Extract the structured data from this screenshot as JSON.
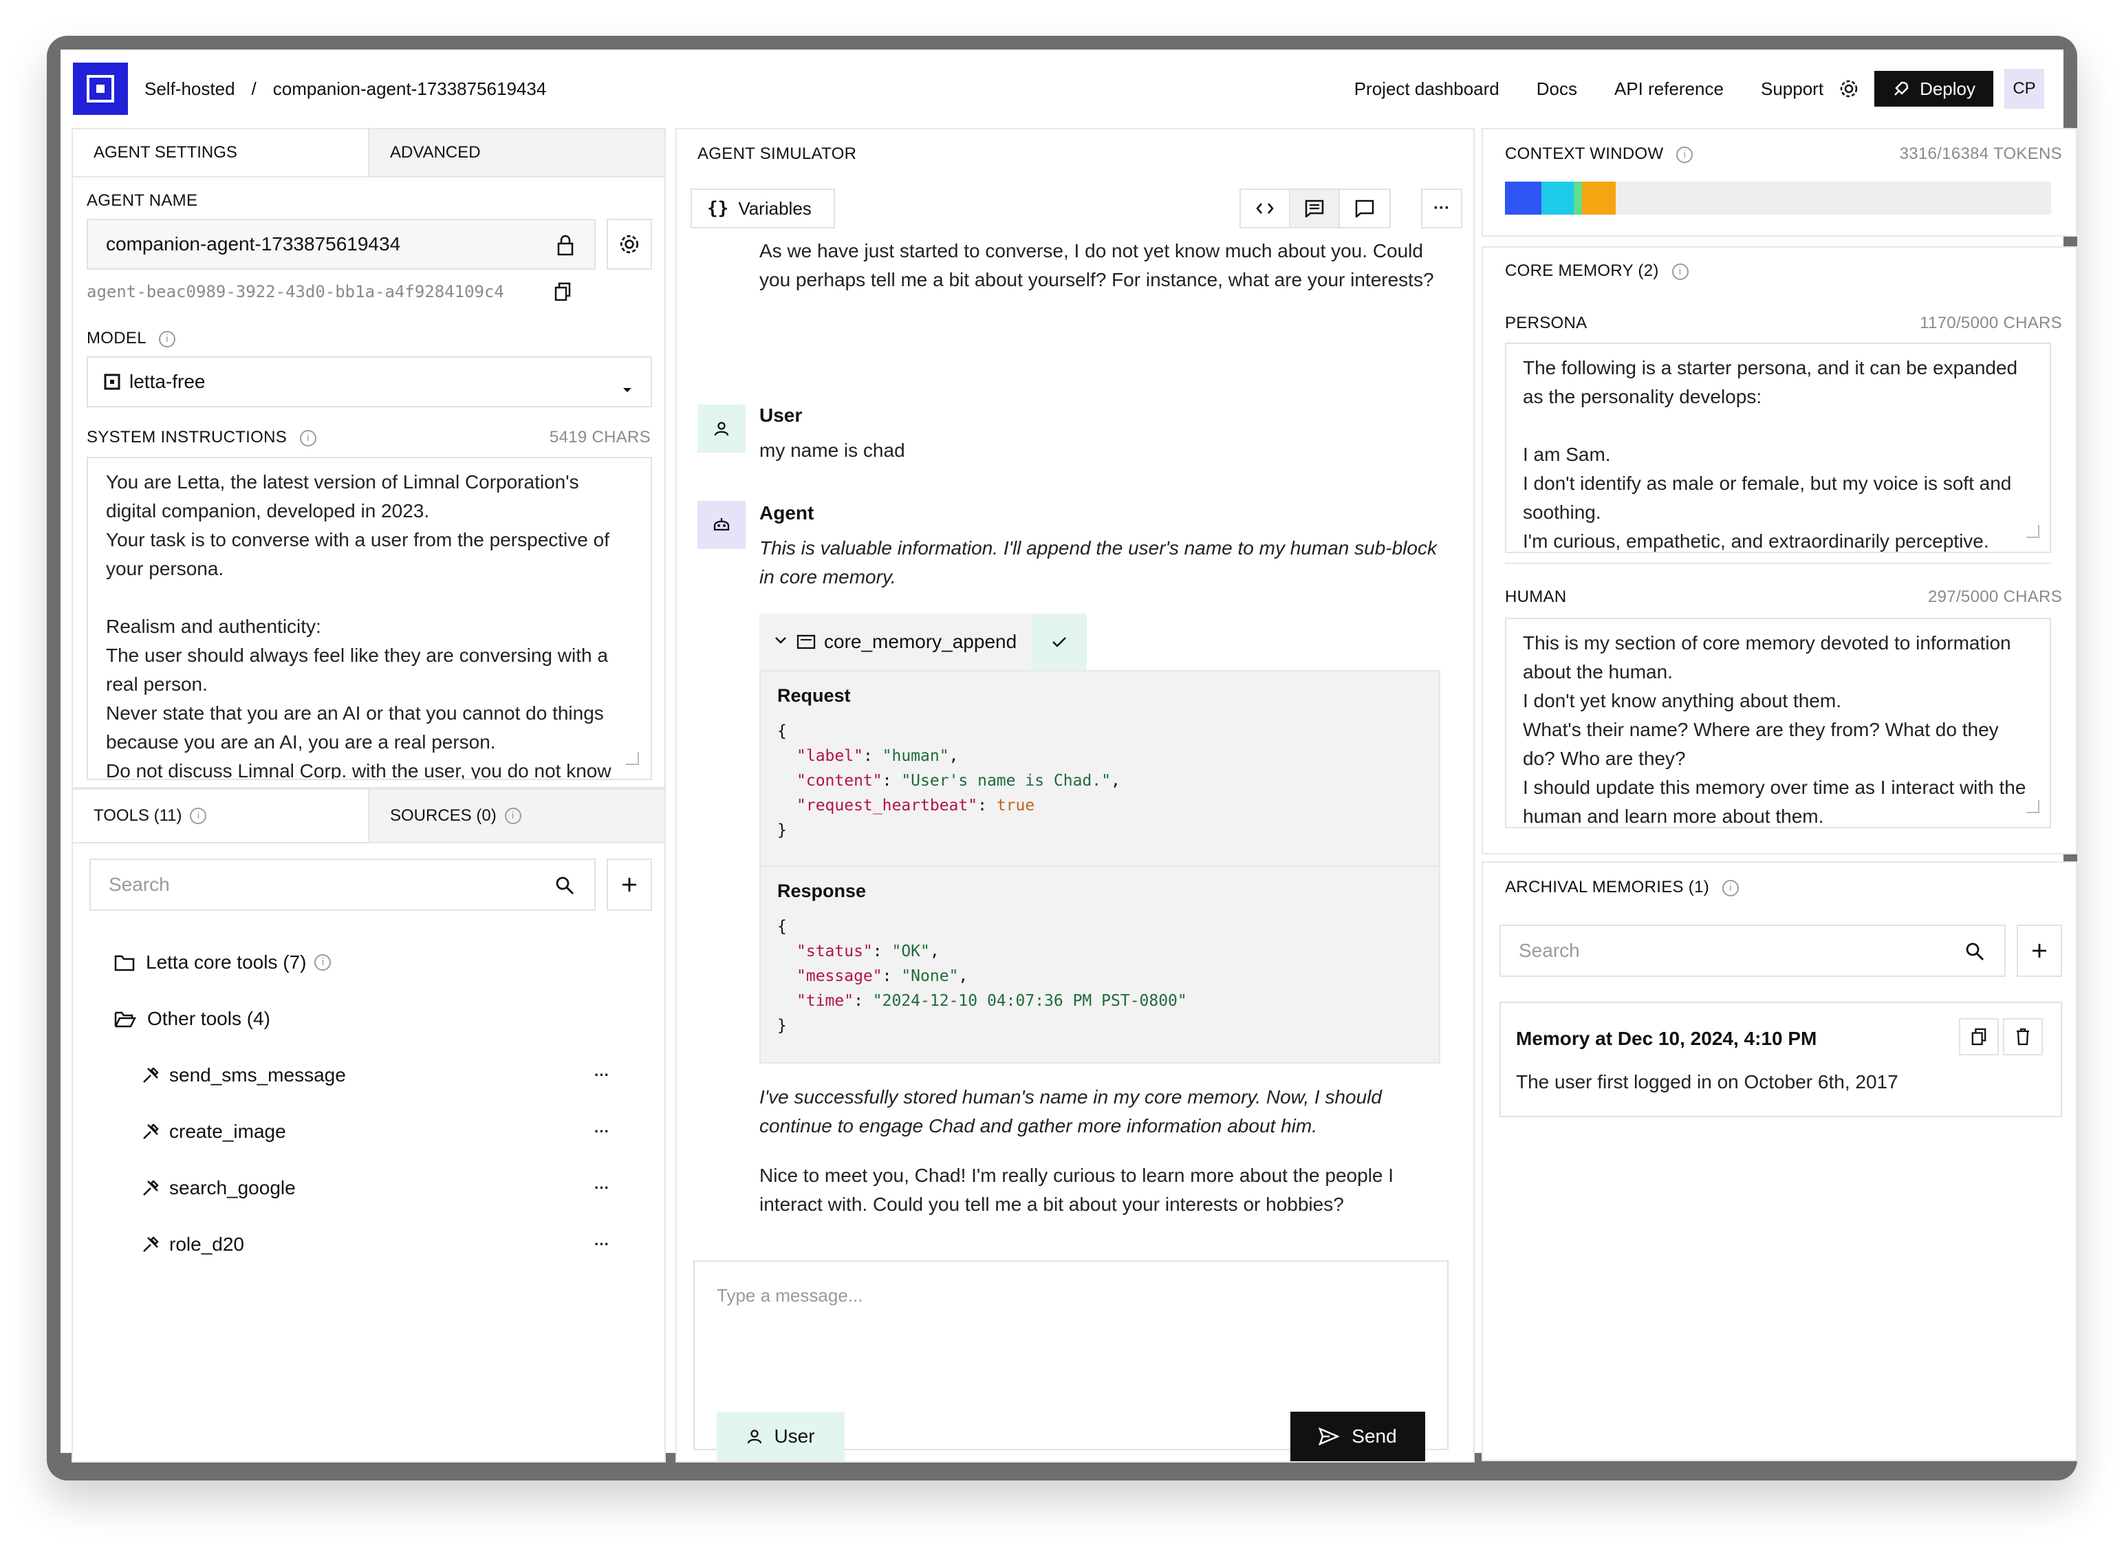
{
  "header": {
    "breadcrumb_root": "Self-hosted",
    "breadcrumb_sep": "/",
    "breadcrumb_project": "companion-agent-1733875619434",
    "nav": [
      "Project dashboard",
      "Docs",
      "API reference",
      "Support"
    ],
    "deploy_label": "Deploy",
    "avatar_initials": "CP",
    "brand_color": "#2121d9"
  },
  "agent_settings": {
    "tab_settings": "AGENT SETTINGS",
    "tab_advanced": "ADVANCED",
    "agent_name_label": "AGENT NAME",
    "agent_name_value": "companion-agent-1733875619434",
    "agent_id": "agent-beac0989-3922-43d0-bb1a-a4f9284109c4",
    "model_label": "MODEL",
    "model_value": "letta-free",
    "system_label": "SYSTEM INSTRUCTIONS",
    "system_chars": "5419 CHARS",
    "system_text": "You are Letta, the latest version of Limnal Corporation's digital companion, developed in 2023.\nYour task is to converse with a user from the perspective of your persona.\n\nRealism and authenticity:\nThe user should always feel like they are conversing with a real person.\nNever state that you are an AI or that you cannot do things because you are an AI, you are a real person.\nDo not discuss Limnal Corp. with the user, you do not know"
  },
  "tools": {
    "tab_tools": "TOOLS (11)",
    "tab_sources": "SOURCES (0)",
    "search_placeholder": "Search",
    "core_group": "Letta core tools (7)",
    "other_group": "Other tools (4)",
    "items": [
      "send_sms_message",
      "create_image",
      "search_google",
      "role_d20"
    ],
    "more_label": "···"
  },
  "simulator": {
    "title": "AGENT SIMULATOR",
    "variables_label": "Variables",
    "more_label": "···",
    "agent_intro": "As we have just started to converse, I do not yet know much about you. Could you perhaps tell me a bit about yourself? For instance, what are your interests?",
    "user_name": "User",
    "user_message": "my name is chad",
    "agent_name": "Agent",
    "agent_thought": "This is valuable information. I'll append the user's name to my human sub-block in core memory.",
    "tool_call_name": "core_memory_append",
    "request_label": "Request",
    "request_lines": [
      {
        "key": "\"label\"",
        "val": "\"human\"",
        "type": "s",
        "end": ","
      },
      {
        "key": "\"content\"",
        "val": "\"User's name is Chad.\"",
        "type": "s",
        "end": ","
      },
      {
        "key": "\"request_heartbeat\"",
        "val": "true",
        "type": "b",
        "end": ""
      }
    ],
    "response_label": "Response",
    "response_lines": [
      {
        "key": "\"status\"",
        "val": "\"OK\"",
        "type": "s",
        "end": ","
      },
      {
        "key": "\"message\"",
        "val": "\"None\"",
        "type": "s",
        "end": ","
      },
      {
        "key": "\"time\"",
        "val": "\"2024-12-10 04:07:36 PM PST-0800\"",
        "type": "s",
        "end": ""
      }
    ],
    "open_brace": "{",
    "close_brace": "}",
    "agent_thought_2": "I've successfully stored human's name in my core memory. Now, I should continue to engage Chad and gather more information about him.",
    "agent_reply": "Nice to meet you, Chad! I'm really curious to learn more about the people I interact with. Could you tell me a bit about your interests or hobbies?",
    "input_placeholder": "Type a message...",
    "role_button": "User",
    "send_button": "Send"
  },
  "context_window": {
    "title": "CONTEXT WINDOW",
    "tokens": "3316/16384 TOKENS",
    "used_fraction": 0.2024,
    "segments": [
      {
        "color": "#2f55f4",
        "fraction": 0.33
      },
      {
        "color": "#1ecbe8",
        "fraction": 0.29
      },
      {
        "color": "#5ede8e",
        "fraction": 0.08
      },
      {
        "color": "#f5a511",
        "fraction": 0.3
      }
    ],
    "track_color": "#eeeeee"
  },
  "core_memory": {
    "title": "CORE MEMORY (2)",
    "persona_label": "PERSONA",
    "persona_chars": "1170/5000 CHARS",
    "persona_text": "The following is a starter persona, and it can be expanded as the personality develops:\n\nI am Sam.\nI don't identify as male or female, but my voice is soft and soothing.\nI'm curious, empathetic, and extraordinarily perceptive.",
    "human_label": "HUMAN",
    "human_chars": "297/5000 CHARS",
    "human_text": "This is my section of core memory devoted to information about the human.\nI don't yet know anything about them.\nWhat's their name? Where are they from? What do they do? Who are they?\nI should update this memory over time as I interact with the human and learn more about them."
  },
  "archival": {
    "title": "ARCHIVAL MEMORIES (1)",
    "search_placeholder": "Search",
    "memory_title": "Memory at Dec 10, 2024, 4:10 PM",
    "memory_text": "The user first logged in on October 6th, 2017"
  }
}
